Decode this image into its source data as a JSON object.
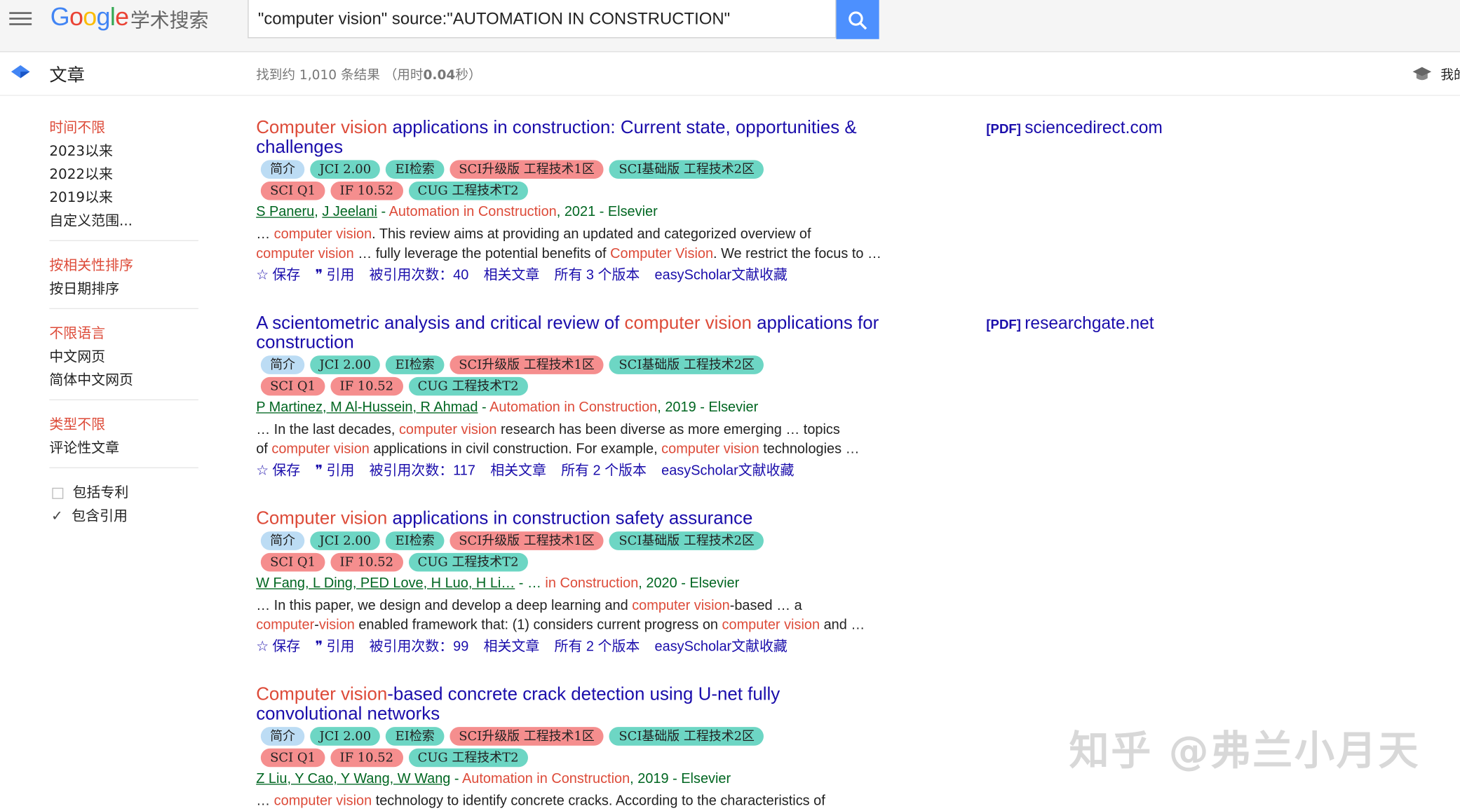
{
  "header": {
    "logo_letters": [
      "G",
      "o",
      "o",
      "g",
      "l",
      "e"
    ],
    "logo_sub": "学术搜索",
    "search_value": "\"computer vision\" source:\"AUTOMATION IN CONSTRUCTION\""
  },
  "subbar": {
    "section_label": "文章",
    "stats_prefix": "找到约 1,010 条结果 （用时",
    "stats_time": "0.04",
    "stats_suffix": "秒）",
    "my_label": "我的"
  },
  "sidebar": {
    "time": [
      "时间不限",
      "2023以来",
      "2022以来",
      "2019以来",
      "自定义范围..."
    ],
    "sort": [
      "按相关性排序",
      "按日期排序"
    ],
    "lang": [
      "不限语言",
      "中文网页",
      "简体中文网页"
    ],
    "type": [
      "类型不限",
      "评论性文章"
    ],
    "include_patents": "包括专利",
    "include_citations": "包含引用"
  },
  "tags": {
    "intro": "简介",
    "jci": "JCI 2.00",
    "ei": "EI检索",
    "sci_up": "SCI升级版 工程技术1区",
    "sci_base": "SCI基础版 工程技术2区",
    "sciq": "SCI Q1",
    "if": "IF 10.52",
    "cug": "CUG 工程技术T2"
  },
  "actions": {
    "save": "保存",
    "cite": "引用",
    "cited_prefix": "被引用次数：",
    "related": "相关文章",
    "easyscholar": "easyScholar文献收藏"
  },
  "results": [
    {
      "title_hl": "Computer vision",
      "title_rest": " applications in construction: Current state, opportunities & challenges",
      "authors": [
        {
          "name": "S Paneru",
          "link": true,
          "sep": ", "
        },
        {
          "name": "J Jeelani",
          "link": true,
          "sep": ""
        }
      ],
      "venue_dash": " - ",
      "venue": "Automation in Construction",
      "year_pub": ", 2021 - Elsevier",
      "snippet1_a": "… ",
      "snippet1_hl": "computer vision",
      "snippet1_b": ". This review aims at providing an updated and categorized overview of",
      "snippet2_hl": "computer vision",
      "snippet2_b": " … fully leverage the potential benefits of ",
      "snippet2_hl2": "Computer Vision",
      "snippet2_c": ". We restrict the focus to …",
      "cited": "40",
      "versions": "所有 3 个版本",
      "side_pdf": "[PDF]",
      "side_site": "sciencedirect.com"
    },
    {
      "title_pre": "A scientometric analysis and critical review of ",
      "title_hl": "computer vision",
      "title_rest": " applications for construction",
      "authors_text": "P Martinez, M Al-Hussein, R Ahmad",
      "venue": "Automation in Construction",
      "year_pub": ", 2019 - Elsevier",
      "snippet1_a": "… In the last decades, ",
      "snippet1_hl": "computer vision",
      "snippet1_b": " research has been diverse as more emerging … topics",
      "snippet2_a": "of ",
      "snippet2_hl": "computer vision",
      "snippet2_b": " applications in civil construction. For example, ",
      "snippet2_hl2": "computer vision",
      "snippet2_c": " technologies …",
      "cited": "117",
      "versions": "所有 2 个版本",
      "side_pdf": "[PDF]",
      "side_site": "researchgate.net"
    },
    {
      "title_hl": "Computer vision",
      "title_rest": " applications in construction safety assurance",
      "authors_text": "W Fang, L Ding, PED Love, H Luo, H Li…",
      "venue_pre": " - … ",
      "venue": "in Construction",
      "year_pub": ", 2020 - Elsevier",
      "snippet1_a": "… In this paper, we design and develop a deep learning and ",
      "snippet1_hl": "computer vision",
      "snippet1_b": "-based … a",
      "snippet2_hl": "computer",
      "snippet2_b": "-",
      "snippet2_hl2": "vision",
      "snippet2_c": " enabled framework that: (1) considers current progress on ",
      "snippet2_hl3": "computer vision",
      "snippet2_d": " and …",
      "cited": "99",
      "versions": "所有 2 个版本"
    },
    {
      "title_hl": "Computer vision",
      "title_rest": "-based concrete crack detection using U-net fully convolutional networks",
      "authors_text": "Z Liu, Y Cao, Y Wang, W Wang",
      "venue": "Automation in Construction",
      "year_pub": ", 2019 - Elsevier",
      "snippet1_a": "… ",
      "snippet1_hl": "computer vision",
      "snippet1_b": " technology to identify concrete cracks. According to the characteristics of"
    }
  ],
  "watermark": "知乎 @弗兰小月天"
}
